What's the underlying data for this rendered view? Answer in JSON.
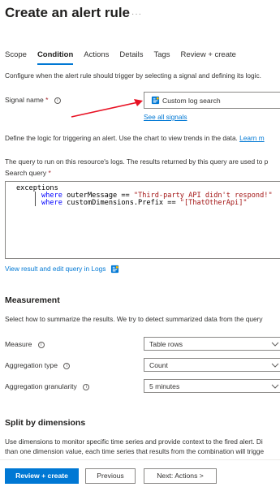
{
  "page": {
    "title": "Create an alert rule",
    "more": "···"
  },
  "tabs": [
    {
      "label": "Scope",
      "active": false
    },
    {
      "label": "Condition",
      "active": true
    },
    {
      "label": "Actions",
      "active": false
    },
    {
      "label": "Details",
      "active": false
    },
    {
      "label": "Tags",
      "active": false
    },
    {
      "label": "Review + create",
      "active": false
    }
  ],
  "condition": {
    "intro": "Configure when the alert rule should trigger by selecting a signal and defining its logic.",
    "signal_label": "Signal name",
    "required_marker": "*",
    "signal_value": "Custom log search",
    "see_all_signals": "See all signals",
    "logic_text": "Define the logic for triggering an alert. Use the chart to view trends in the data.",
    "learn_more": "Learn m",
    "query_text": "The query to run on this resource's logs. The results returned by this query are used to p",
    "search_query_label": "Search query",
    "query_lines": [
      {
        "indent": "exceptions",
        "kw": "",
        "pre": "",
        "str": ""
      },
      {
        "indent": "    | ",
        "kw": "where",
        "pre": " outerMessage == ",
        "str": "\"Third-party API didn't respond!\""
      },
      {
        "indent": "    | ",
        "kw": "where",
        "pre": " customDimensions.Prefix == ",
        "str": "\"[ThatOtherApi]\""
      }
    ],
    "view_result_link": "View result and edit query in Logs"
  },
  "measurement": {
    "heading": "Measurement",
    "description": "Select how to summarize the results. We try to detect summarized data from the query",
    "measure_label": "Measure",
    "measure_value": "Table rows",
    "aggregation_type_label": "Aggregation type",
    "aggregation_type_value": "Count",
    "aggregation_granularity_label": "Aggregation granularity",
    "aggregation_granularity_value": "5 minutes"
  },
  "split": {
    "heading": "Split by dimensions",
    "line1": "Use dimensions to monitor specific time series and provide context to the fired alert. Di",
    "line2": "than one dimension value, each time series that results from the combination will trigge"
  },
  "footer": {
    "review_create": "Review + create",
    "previous": "Previous",
    "next": "Next: Actions >"
  },
  "colors": {
    "accent": "#0078d4",
    "arrow": "#e81123"
  },
  "icons": {
    "info": "info-icon",
    "signal": "log-search-icon",
    "logs": "log-analytics-icon",
    "chevron": "chevron-down-icon",
    "arrow": "red-arrow-annotation"
  }
}
